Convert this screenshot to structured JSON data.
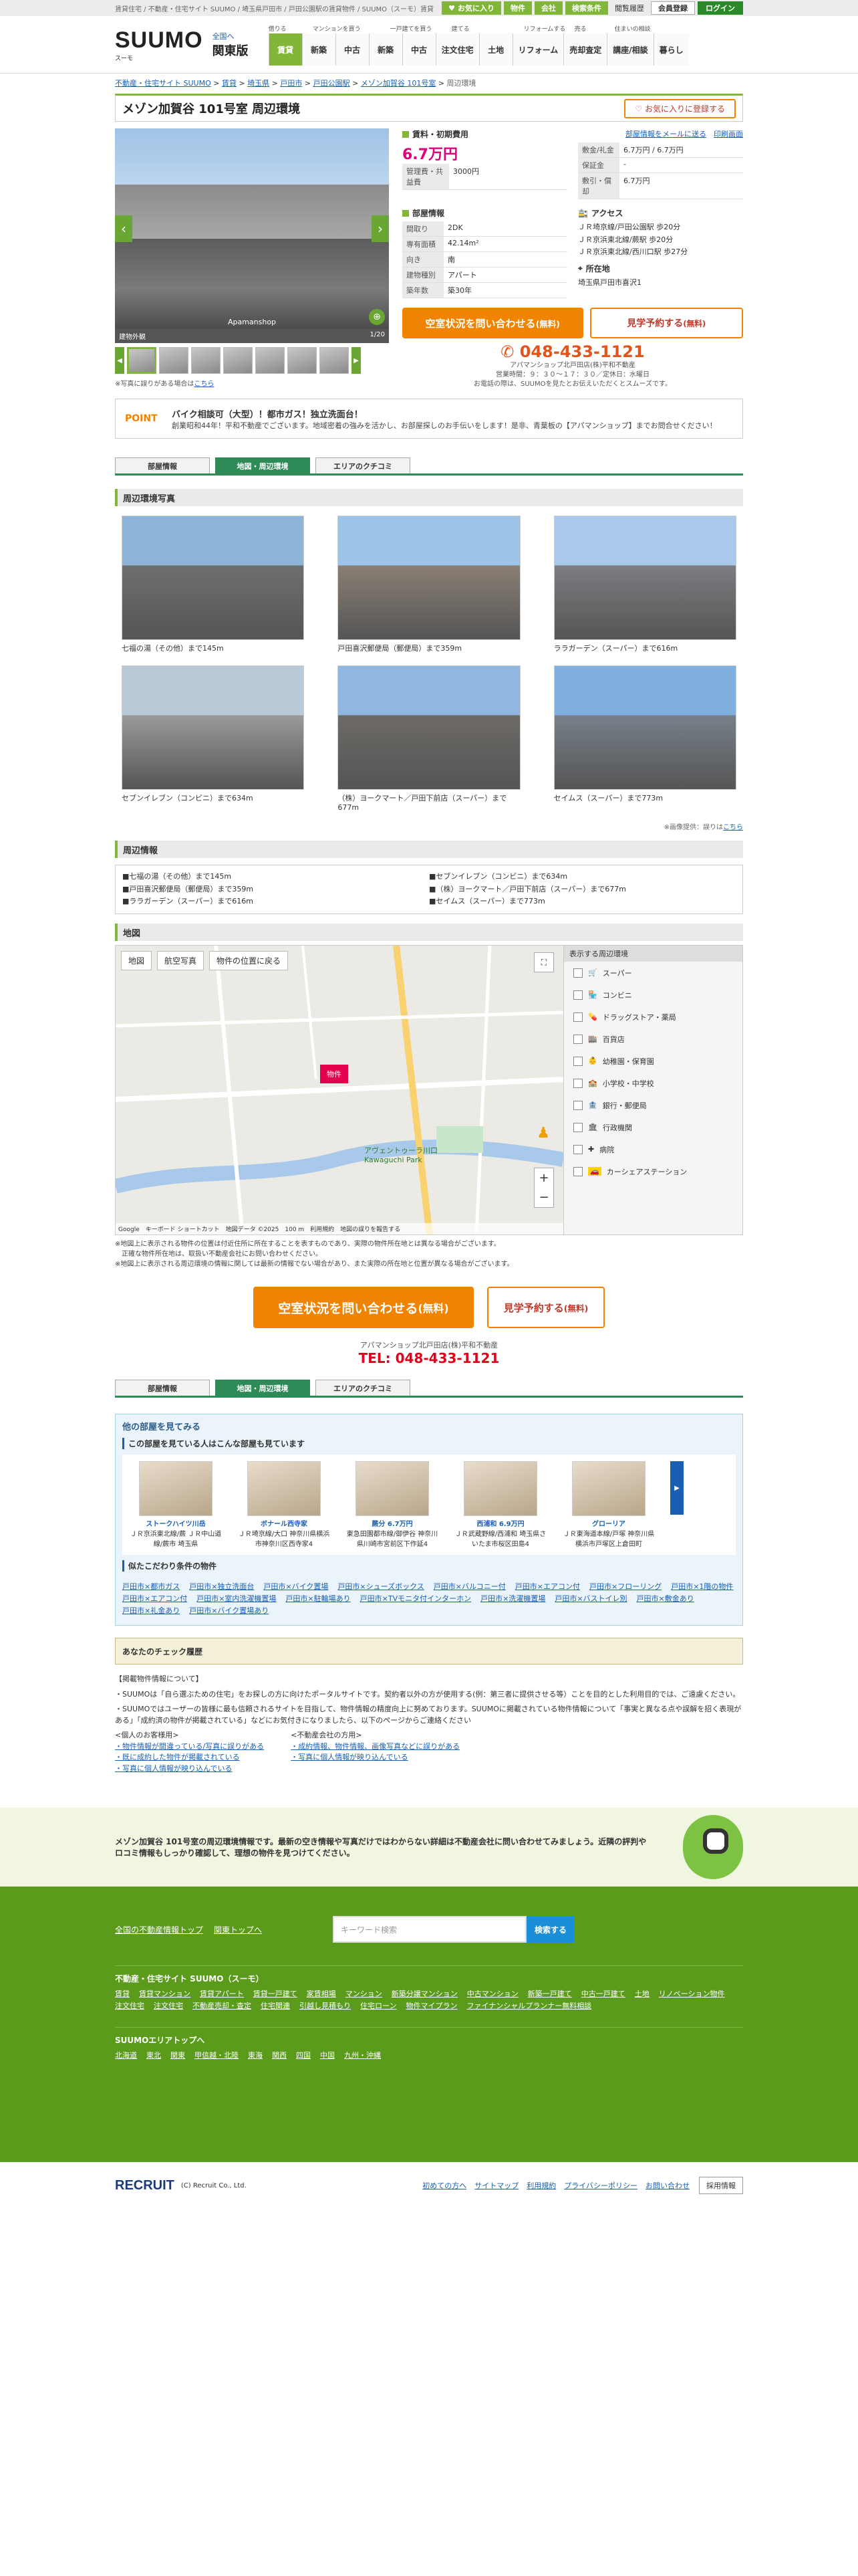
{
  "topbar": {
    "breadcrumb_text": "賃貸住宅 / 不動産・住宅サイト SUUMO / 埼玉県戸田市 / 戸田公園駅の賃貸物件 / SUUMO（スーモ）賃貸",
    "link1": "お気に入り",
    "link2": "物件",
    "link3": "会社",
    "link4": "検索条件",
    "help": "閲覧履歴",
    "register": "会員登録",
    "login": "ログイン"
  },
  "header": {
    "logo": "SUUMO",
    "logo_sub": "スーモ",
    "region_link": "全国へ",
    "region": "関東版",
    "cats": [
      "借りる",
      "マンションを買う",
      "一戸建てを買う",
      "建てる",
      "リフォームする",
      "売る",
      "住まいの相談"
    ],
    "nav": [
      "賃貸",
      "新築",
      "中古",
      "新築",
      "中古",
      "注文住宅",
      "土地",
      "リフォーム",
      "売却査定",
      "講座/相談",
      "暮らし"
    ]
  },
  "breadcrumb": [
    "不動産・住宅サイト SUUMO",
    "賃貸",
    "埼玉県",
    "戸田市",
    "戸田公園駅",
    "メゾン加賀谷 101号室",
    "周辺環境"
  ],
  "title": {
    "name": "メゾン加賀谷 101号室 周辺環境",
    "fav": "お気に入りに登録する"
  },
  "gallery": {
    "caption": "Apamanshop",
    "label": "建物外観",
    "count": "1/20",
    "note": "※写真に誤りがある場合は",
    "note_link": "こちら"
  },
  "info": {
    "mail_link": "部屋情報をメールに送る",
    "print_link": "印刷画面",
    "rent_heading": "賃料・初期費用",
    "price": "6.7万円",
    "kanri_k": "管理費・共益費",
    "kanri_v": "3000円",
    "right_costs": [
      {
        "k": "敷金/礼金",
        "v": "6.7万円 / 6.7万円"
      },
      {
        "k": "保証金",
        "v": "-"
      },
      {
        "k": "敷引・償却",
        "v": "6.7万円"
      }
    ],
    "room_heading": "部屋情報",
    "room": [
      {
        "k": "間取り",
        "v": "2DK"
      },
      {
        "k": "専有面積",
        "v": "42.14m²"
      },
      {
        "k": "向き",
        "v": "南"
      },
      {
        "k": "建物種別",
        "v": "アパート"
      },
      {
        "k": "築年数",
        "v": "築30年"
      }
    ],
    "access_heading": "アクセス",
    "access": [
      "ＪＲ埼京線/戸田公園駅 歩20分",
      "ＪＲ京浜東北線/蕨駅 歩20分",
      "ＪＲ京浜東北線/西川口駅 歩27分"
    ],
    "addr_heading": "所在地",
    "addr": "埼玉県戸田市喜沢1",
    "cta_vacancy": "空室状況を問い合わせる",
    "cta_free": "(無料)",
    "cta_visit": "見学予約する",
    "tel": "048-433-1121",
    "shop": "アパマンショップ北戸田店(株)平和不動産",
    "hours": "営業時間：９：３０～１７：３０／定休日：水曜日",
    "phone_note": "お電話の際は、SUUMOを見たとお伝えいただくとスムーズです。"
  },
  "point": {
    "label": "POINT",
    "title": "バイク相談可（大型）！都市ガス！独立洗面台！",
    "body": "創業昭和44年！平和不動産でございます。地域密着の強みを活かし、お部屋探しのお手伝いをします！是非、青葉板の【アパマンショップ】までお問合せください！"
  },
  "tabs": [
    "部屋情報",
    "地図・周辺環境",
    "エリアのクチコミ"
  ],
  "photos_heading": "周辺環境写真",
  "photos": [
    {
      "label": "七福の湯（その他）まで145m",
      "c1": "#8eb4d8",
      "c2": "#6f6f6f"
    },
    {
      "label": "戸田喜沢郵便局（郵便局）まで359m",
      "c1": "#9ec3e8",
      "c2": "#8a7f75"
    },
    {
      "label": "ララガーデン（スーパー）まで616m",
      "c1": "#a9c9ea",
      "c2": "#7d7d82"
    },
    {
      "label": "セブンイレブン（コンビニ）まで634m",
      "c1": "#b8c9d8",
      "c2": "#9a9a9a"
    },
    {
      "label": "（株）ヨークマート／戸田下前店（スーパー）まで677m",
      "c1": "#8fb7e2",
      "c2": "#6d6a66"
    },
    {
      "label": "セイムス（スーパー）まで773m",
      "c1": "#7fb0e0",
      "c2": "#77808a"
    }
  ],
  "photos_note": "※画像提供：誤りは",
  "photos_note_link": "こちら",
  "surround_heading": "周辺情報",
  "surround": [
    "■七福の湯（その他）まで145m",
    "■セブンイレブン（コンビニ）まで634m",
    "■戸田喜沢郵便局（郵便局）まで359m",
    "■（株）ヨークマート／戸田下前店（スーパー）まで677m",
    "■ララガーデン（スーパー）まで616m",
    "■セイムス（スーパー）まで773m"
  ],
  "map": {
    "heading": "地図",
    "btn_map": "地図",
    "btn_sat": "航空写真",
    "btn_back": "物件の位置に戻る",
    "marker": "物件",
    "poi": "アヴェントゥーラ川口Kawaguchi Park",
    "attrib": "Google　キーボード ショートカット　地図データ ©2025　100 m　利用規約　地図の誤りを報告する",
    "legend_head": "表示する周辺環境",
    "legend": [
      "スーパー",
      "コンビニ",
      "ドラッグストア・薬局",
      "百貨店",
      "幼稚園・保育園",
      "小学校・中学校",
      "銀行・郵便局",
      "行政機関",
      "病院",
      "カーシェアステーション"
    ],
    "note1": "※地図上に表示される物件の位置は付近住所に所在することを表すものであり、実際の物件所在地とは異なる場合がございます。",
    "note2": "　正確な物件所在地は、取扱い不動産会社にお問い合わせください。",
    "note3": "※地図上に表示される周辺環境の情報に関しては最新の情報でない場合があり、また実際の所在地と位置が異なる場合がございます。"
  },
  "cta2": {
    "vacancy": "空室状況を問い合わせる",
    "free": "(無料)",
    "visit": "見学予約する",
    "shop": "アパマンショップ北戸田店(株)平和不動産",
    "tel": "TEL: 048-433-1121"
  },
  "other": {
    "heading": "他の部屋を見てみる",
    "sub": "この部屋を見ている人はこんな部屋も見ています",
    "rooms": [
      {
        "name": "ストークハイツ川岳",
        "desc": "ＪＲ京浜東北線/蕨 ＪＲ中山道線/蕨市 埼玉県"
      },
      {
        "name": "ボナール西寺家",
        "desc": "ＪＲ埼京線/大口 神奈川県横浜市神奈川区西寺家4"
      },
      {
        "name": "蕨分 6.7万円",
        "desc": "東急田園都市線/御伊谷 神奈川県川崎市宮前区下作延4"
      },
      {
        "name": "西浦和 6.9万円",
        "desc": "ＪＲ武蔵野線/西浦和 埼玉県さいたま市桜区田島4"
      },
      {
        "name": "グローリア",
        "desc": "ＪＲ東海道本線/戸塚 神奈川県横浜市戸塚区上倉田町"
      }
    ],
    "tags_heading": "似たこだわり条件の物件",
    "tags": [
      "戸田市×都市ガス",
      "戸田市×独立洗面台",
      "戸田市×バイク置場",
      "戸田市×シューズボックス",
      "戸田市×バルコニー付",
      "戸田市×エアコン付",
      "戸田市×フローリング",
      "戸田市×1階の物件",
      "戸田市×エアコン付",
      "戸田市×室内洗濯機置場",
      "戸田市×駐輪場あり",
      "戸田市×TVモニタ付インターホン",
      "戸田市×洗濯機置場",
      "戸田市×バストイレ別",
      "戸田市×敷金あり",
      "戸田市×礼金あり",
      "戸田市×バイク置場あり"
    ]
  },
  "history": "あなたのチェック履歴",
  "disclaimer": {
    "h": "【掲載物件情報について】",
    "p1": "・SUUMOは「自ら選ぶための住宅」をお探しの方に向けたポータルサイトです。契約者以外の方が使用する(例：第三者に提供させる等）ことを目的とした利用目的では、ご遠慮ください。",
    "p2": "・SUUMOではユーザーの皆様に最も信頼されるサイトを目指して、物件情報の精度向上に努めております。SUUMOに掲載されている物件情報について「事実と異なる点や誤解を招く表現がある」「成約済の物件が掲載されている」などにお気付きになりましたら、以下のページからご連絡ください",
    "l1": "<個人のお客様用>",
    "l2": "・物件情報が間違っている/写真に誤りがある",
    "l3": "・既に成約した物件が掲載されている",
    "l4": "・写真に個人情報が映り込んでいる",
    "r1": "<不動産会社の方用>",
    "r2": "・成約情報、物件情報、画像写真などに誤りがある",
    "r3": "・写真に個人情報が映り込んでいる"
  },
  "banner": "メゾン加賀谷 101号室の周辺環境情報です。最新の空き情報や写真だけではわからない詳細は不動産会社に問い合わせてみましょう。近隣の評判やロコミ情報もしっかり確認して、理想の物件を見つけてください。",
  "footer": {
    "link_top": "全国の不動産情報トップ",
    "link_kanto": "関東トップへ",
    "search_ph": "キーワード検索",
    "search_btn": "検索する",
    "sec1": "不動産・住宅サイト SUUMO（スーモ）",
    "sec1_links": [
      "賃貸",
      "賃貸マンション",
      "賃貸アパート",
      "賃貸一戸建て",
      "家賃相場",
      "マンション",
      "新築分譲マンション",
      "中古マンション",
      "新築一戸建て",
      "中古一戸建て",
      "土地",
      "リノベーション物件",
      "注文住宅",
      "注文住宅",
      "不動産売却・査定",
      "住宅関連",
      "引越し見積もり",
      "住宅ローン",
      "物件マイプラン",
      "ファイナンシャルプランナー無料相談"
    ],
    "sec2": "SUUMOエリアトップへ",
    "sec2_links": [
      "北海道",
      "東北",
      "関東",
      "甲信越・北陸",
      "東海",
      "関西",
      "四国",
      "中国",
      "九州・沖縄"
    ],
    "copy": "(C) Recruit Co., Ltd.",
    "brand": "RECRUIT",
    "blinks": [
      "初めての方へ",
      "サイトマップ",
      "利用規約",
      "プライバシーポリシー",
      "お問い合わせ"
    ],
    "lang": "採用情報"
  }
}
